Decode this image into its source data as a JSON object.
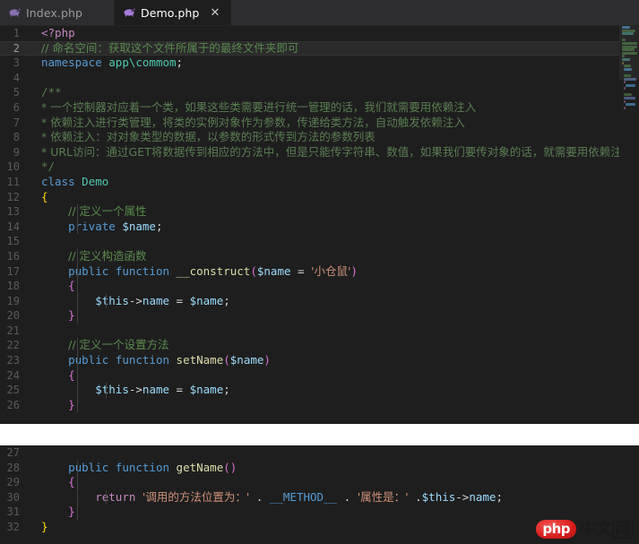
{
  "window": {
    "title": "Demo.php",
    "theme_bg": "#1e1e1e",
    "tabbar_bg": "#2d2d30",
    "accent": "#8a6fb0"
  },
  "tabs": [
    {
      "label": "Index.php",
      "icon": "php-elephant-icon",
      "active": false,
      "close_label": "×"
    },
    {
      "label": "Demo.php",
      "icon": "php-elephant-icon",
      "active": true,
      "close_label": "✕"
    }
  ],
  "editor_top": {
    "lines": [
      {
        "n": "1",
        "current": false
      },
      {
        "n": "2",
        "current": true
      },
      {
        "n": "3",
        "current": false
      },
      {
        "n": "4",
        "current": false
      },
      {
        "n": "5",
        "current": false
      },
      {
        "n": "6",
        "current": false
      },
      {
        "n": "7",
        "current": false
      },
      {
        "n": "8",
        "current": false
      },
      {
        "n": "9",
        "current": false
      },
      {
        "n": "10",
        "current": false
      },
      {
        "n": "11",
        "current": false
      },
      {
        "n": "12",
        "current": false
      },
      {
        "n": "13",
        "current": false
      },
      {
        "n": "14",
        "current": false
      },
      {
        "n": "15",
        "current": false
      },
      {
        "n": "16",
        "current": false
      },
      {
        "n": "17",
        "current": false
      },
      {
        "n": "18",
        "current": false
      },
      {
        "n": "19",
        "current": false
      },
      {
        "n": "20",
        "current": false
      },
      {
        "n": "21",
        "current": false
      },
      {
        "n": "22",
        "current": false
      },
      {
        "n": "23",
        "current": false
      },
      {
        "n": "24",
        "current": false
      },
      {
        "n": "25",
        "current": false
      },
      {
        "n": "26",
        "current": false
      }
    ],
    "code": {
      "l1_php_open": "<?php",
      "l2_comment": "// 命名空间：获取这个文件所属于的最终文件夹即可",
      "l3_kw": "namespace",
      "l3_ns": "app\\commom",
      "l3_semi": ";",
      "l5_doc_open": "/**",
      "l6_doc": "* 一个控制器对应着一个类，如果这些类需要进行统一管理的话，我们就需要用依赖注入",
      "l7_doc": "* 依赖注入进行类管理，将类的实例对象作为参数，传递给类方法，自动触发依赖注入",
      "l8_doc": "* 依赖注入：对对象类型的数据，以参数的形式传到方法的参数列表",
      "l9_doc": "* URL访问：通过GET将数据传到相应的方法中，但是只能传字符串、数值，如果我们要传对象的话，就需要用依赖注入",
      "l10_doc_close": "*/",
      "l11_kw": "class",
      "l11_name": "Demo",
      "l12_brace": "{",
      "l13_comment": "// 定义一个属性",
      "l14_kw": "private",
      "l14_var": "$name",
      "l14_semi": ";",
      "l16_comment": "// 定义构造函数",
      "l17_kw1": "public",
      "l17_kw2": "function",
      "l17_fn": "__construct",
      "l17_open": "(",
      "l17_param": "$name",
      "l17_eq": " = ",
      "l17_str": "'小仓鼠'",
      "l17_close": ")",
      "l18_brace": "{",
      "l19_this": "$this",
      "l19_arrow": "->",
      "l19_prop": "name",
      "l19_eq": " = ",
      "l19_var": "$name",
      "l19_semi": ";",
      "l20_brace": "}",
      "l22_comment": "// 定义一个设置方法",
      "l23_kw1": "public",
      "l23_kw2": "function",
      "l23_fn": "setName",
      "l23_open": "(",
      "l23_param": "$name",
      "l23_close": ")",
      "l24_brace": "{",
      "l25_this": "$this",
      "l25_arrow": "->",
      "l25_prop": "name",
      "l25_eq": " = ",
      "l25_var": "$name",
      "l25_semi": ";",
      "l26_brace": "}"
    }
  },
  "editor_bottom": {
    "lines": [
      {
        "n": "27",
        "current": false
      },
      {
        "n": "28",
        "current": false
      },
      {
        "n": "29",
        "current": false
      },
      {
        "n": "30",
        "current": false
      },
      {
        "n": "31",
        "current": false
      },
      {
        "n": "32",
        "current": false
      }
    ],
    "code": {
      "l28_kw1": "public",
      "l28_kw2": "function",
      "l28_fn": "getName",
      "l28_parens": "()",
      "l29_brace": "{",
      "l30_kw": "return",
      "l30_str1": "'调用的方法位置为：'",
      "l30_dot1": " . ",
      "l30_const": "__METHOD__",
      "l30_dot2": " . ",
      "l30_str2": "'属性是：'",
      "l30_dot3": " .",
      "l30_this": "$this",
      "l30_arrow": "->",
      "l30_prop": "name",
      "l30_semi": ";",
      "l31_brace": "}",
      "l32_brace": "}"
    }
  },
  "watermark": {
    "badge": "php",
    "text_1": "中文",
    "text_2": "网",
    "badge_color": "#d81e1e"
  },
  "minimap": {
    "present": true,
    "slider_label": "minimap-viewport-slider"
  }
}
